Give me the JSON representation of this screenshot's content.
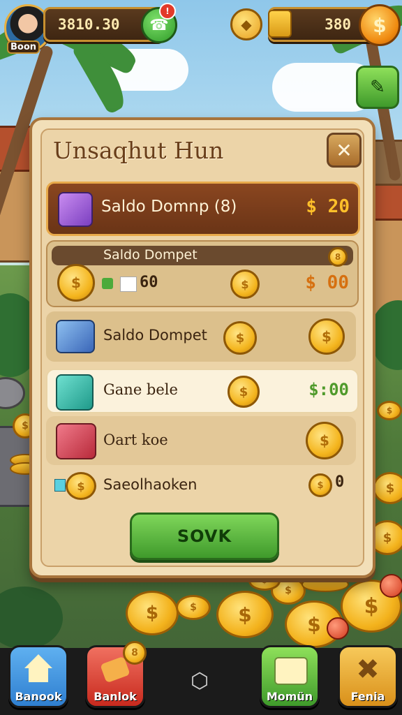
{
  "hud": {
    "avatar_name": "Boon",
    "balance": "3810.30",
    "alert_badge": "!",
    "right_value": "380",
    "coin_symbol": "$"
  },
  "modal": {
    "title": "Unsaqhut Hun",
    "close_symbol": "✕",
    "rows": [
      {
        "label": "Saldo Domnp (8)",
        "value": "$ 20"
      },
      {
        "label": "Saldo Dompet",
        "sub_value": "60",
        "value": "$ 00",
        "badge": "8"
      },
      {
        "label": "Saldo Dompet"
      },
      {
        "label": "Gane bele",
        "value": "$:00"
      },
      {
        "label": "Oart koe"
      },
      {
        "label": "Saeolhaoken",
        "value": "0"
      }
    ],
    "button_label": "SOVK"
  },
  "nav": {
    "items": [
      {
        "label": "Banook"
      },
      {
        "label": "Banlok",
        "badge": "8"
      },
      {
        "label": "Momün"
      },
      {
        "label": "Fenia"
      }
    ]
  },
  "colors": {
    "accent_gold": "#f4b51e",
    "modal_bg": "#f2dfb8",
    "header_row_bg": "#7a3f1d",
    "green_button": "#3f9a2b",
    "home_blue": "#2f7fd0",
    "red_nav": "#d63a2a",
    "value_orange": "#e07a10",
    "value_green": "#4f9a2b"
  }
}
